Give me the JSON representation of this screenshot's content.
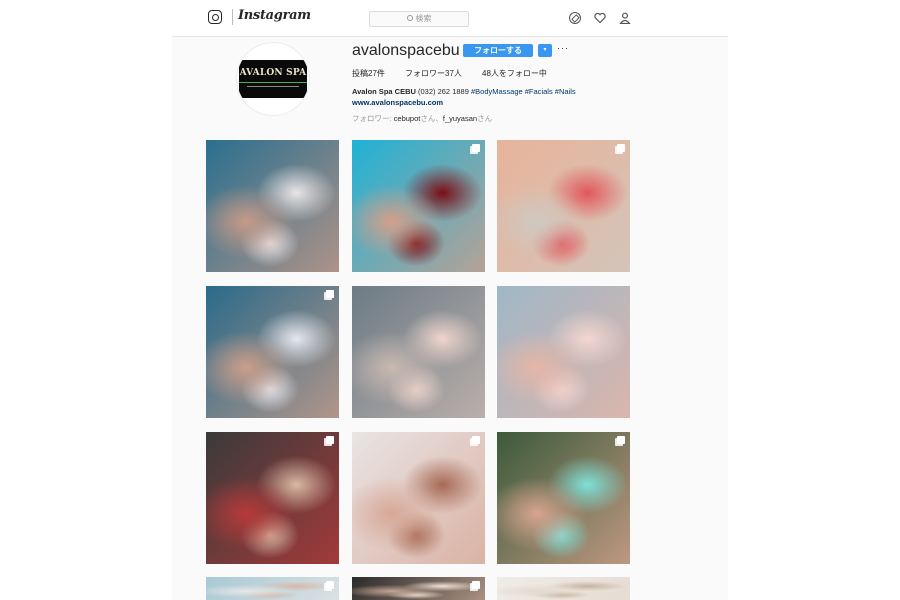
{
  "topbar": {
    "wordmark": "Instagram",
    "search_placeholder": "検索",
    "icons": [
      "instagram-camera-icon",
      "compass-icon",
      "heart-icon",
      "person-icon"
    ]
  },
  "profile": {
    "username": "avalonspacebu",
    "follow_label": "フォローする",
    "dropdown_label": "▾",
    "more_label": "···",
    "avatar_text": "AVALON SPA",
    "stats": {
      "posts": "投稿27件",
      "followers": "フォロワー37人",
      "following": "48人をフォロー中"
    },
    "bio": {
      "name": "Avalon Spa CEBU",
      "phone": "(032) 262 1889",
      "tags": [
        "#BodyMassage",
        "#Facials",
        "#Nails"
      ],
      "website": "www.avalonspacebu.com"
    },
    "followed_by": {
      "prefix": "フォロワー: ",
      "user1": "cebupot",
      "sep": "さん、",
      "user2": "f_yuyasan",
      "suffix": "さん"
    }
  },
  "grid": [
    {
      "subject": "blue and white decorated nails",
      "multi": false,
      "colors": [
        "#2a6f8f",
        "#e9e4e6",
        "#c79a88"
      ]
    },
    {
      "subject": "dark red nails on blue background",
      "multi": true,
      "colors": [
        "#1fb2d6",
        "#7a0f17",
        "#d39f8a"
      ]
    },
    {
      "subject": "coral and silver glitter nails",
      "multi": true,
      "colors": [
        "#e8b39a",
        "#e2575b",
        "#cfc8c0"
      ]
    },
    {
      "subject": "blue and white nails with gems",
      "multi": true,
      "colors": [
        "#2b6a8a",
        "#e6e8ee",
        "#cc9e8a"
      ]
    },
    {
      "subject": "nude nails with rhinestones",
      "multi": false,
      "colors": [
        "#6c7b86",
        "#efd5cc",
        "#c9b9b2"
      ]
    },
    {
      "subject": "pale pink french nails",
      "multi": false,
      "colors": [
        "#9fb7c7",
        "#f3d6d1",
        "#e6b5a7"
      ]
    },
    {
      "subject": "eyelash extensions",
      "multi": true,
      "colors": [
        "#3a3a3a",
        "#d9b8a3",
        "#b73a3a"
      ]
    },
    {
      "subject": "nude gradient nails",
      "multi": true,
      "colors": [
        "#e9e4e4",
        "#a66a55",
        "#d7a897"
      ]
    },
    {
      "subject": "white and teal nails with gems",
      "multi": true,
      "colors": [
        "#3b5a3a",
        "#7ee0d8",
        "#d7a48f"
      ]
    },
    {
      "subject": "partial tile row",
      "multi": true,
      "colors": [
        "#a8c9d4",
        "#d8b8a8",
        "#e6e6e6"
      ]
    },
    {
      "subject": "partial tile row",
      "multi": true,
      "colors": [
        "#2a2a2a",
        "#efe1d6",
        "#c4a594"
      ]
    },
    {
      "subject": "partial tile row",
      "multi": false,
      "colors": [
        "#f0ece8",
        "#c7b39f",
        "#e3d9cf"
      ]
    }
  ]
}
